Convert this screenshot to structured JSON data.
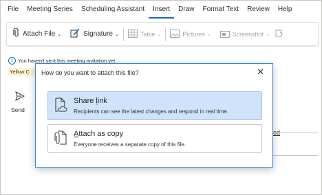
{
  "menu": [
    "File",
    "Meeting Series",
    "Scheduling Assistant",
    "Insert",
    "Draw",
    "Format Text",
    "Review",
    "Help"
  ],
  "active_menu_index": 3,
  "toolbar": {
    "attach_file": "Attach File",
    "signature": "Signature",
    "table": "Table",
    "pictures": "Pictures",
    "screenshot": "Screenshot"
  },
  "info_text": "You haven't sent this meeting invitation yet.",
  "yellow_text": "Yellow C",
  "send_label": "Send",
  "background_link": "ood",
  "dialog": {
    "title": "How do you want to attach this file?",
    "options": [
      {
        "title_underline": "S",
        "title_rest": "hare link",
        "title_underline_pos": "l",
        "description": "Recipients can see the latest changes and respond in real time.",
        "selected": true
      },
      {
        "title_underline": "A",
        "title_rest": "ttach as copy",
        "description": "Everyone receives a separate copy of this file.",
        "selected": false
      }
    ]
  },
  "colors": {
    "accent": "#0f6cbd",
    "selected_bg": "#cfe4fa",
    "banner_yellow": "#fff4ce"
  }
}
